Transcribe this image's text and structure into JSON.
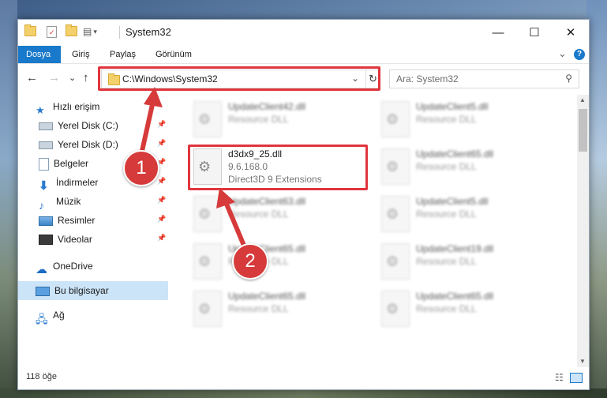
{
  "window": {
    "title": "System32",
    "minimize": "—",
    "maximize": "☐",
    "close": "✕"
  },
  "ribbon": {
    "tabs": [
      "Dosya",
      "Giriş",
      "Paylaş",
      "Görünüm"
    ],
    "expand": "⌄",
    "help": "?"
  },
  "address": {
    "path": "C:\\Windows\\System32",
    "dropdown": "⌄",
    "refresh": "↻"
  },
  "search": {
    "placeholder": "Ara: System32"
  },
  "nav": {
    "back": "←",
    "forward": "→",
    "recent": "⌄",
    "up": "↑",
    "items": [
      {
        "label": "Hızlı erişim"
      },
      {
        "label": "Yerel Disk (C:)"
      },
      {
        "label": "Yerel Disk (D:)"
      },
      {
        "label": "Belgeler"
      },
      {
        "label": "İndirmeler"
      },
      {
        "label": "Müzik"
      },
      {
        "label": "Resimler"
      },
      {
        "label": "Videolar"
      },
      {
        "label": "OneDrive"
      },
      {
        "label": "Bu bilgisayar"
      },
      {
        "label": "Ağ"
      }
    ]
  },
  "files": [
    {
      "name": "UpdateClient42.dll",
      "sub": "Resource DLL"
    },
    {
      "name": "UpdateClient5.dll",
      "sub": "Resource DLL"
    },
    {
      "name": "d3dx9_25.dll",
      "sub": "9.6.168.0",
      "sub2": "Direct3D 9 Extensions"
    },
    {
      "name": "UpdateClient65.dll",
      "sub": "Resource DLL"
    },
    {
      "name": "UpdateClient63.dll",
      "sub": "Resource DLL"
    },
    {
      "name": "UpdateClient5.dll",
      "sub": "Resource DLL"
    },
    {
      "name": "UpdateClient65.dll",
      "sub": "Resource DLL"
    },
    {
      "name": "UpdateClient19.dll",
      "sub": "Resource DLL"
    },
    {
      "name": "UpdateClient65.dll",
      "sub": "Resource DLL"
    },
    {
      "name": "UpdateClient65.dll",
      "sub": "Resource DLL"
    }
  ],
  "status": {
    "count": "118 öğe"
  },
  "annotations": {
    "badge1": "1",
    "badge2": "2"
  },
  "colors": {
    "accent": "#1979ca",
    "highlight": "#e0353d"
  }
}
